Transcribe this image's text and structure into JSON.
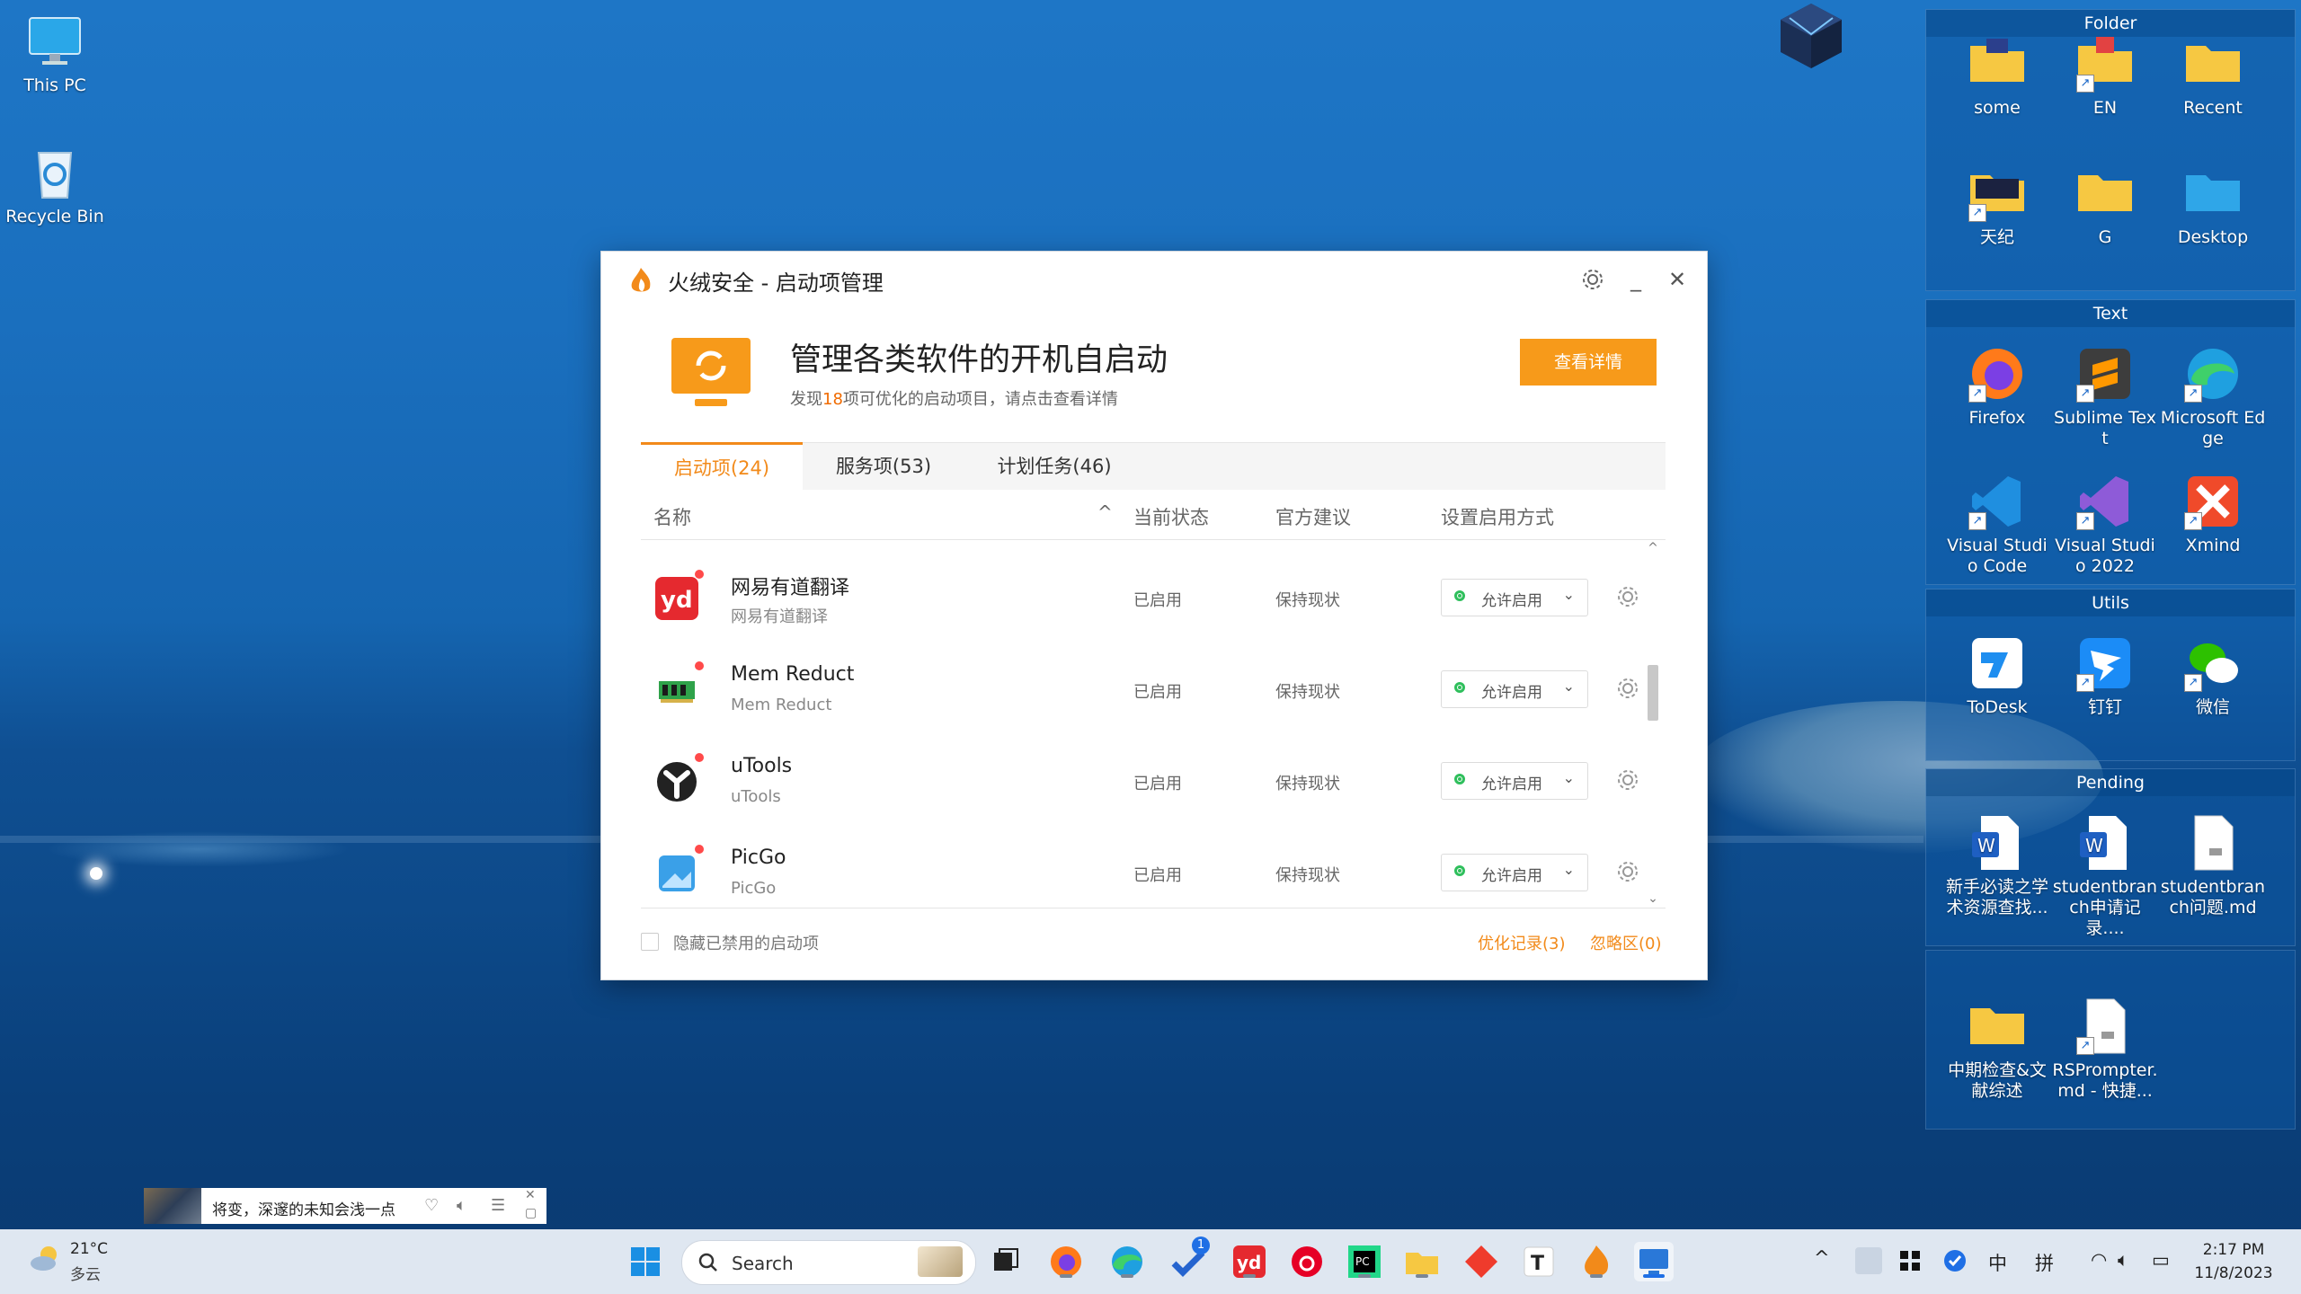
{
  "desktop": {
    "icons": [
      {
        "label": "This PC"
      },
      {
        "label": "Recycle Bin"
      }
    ]
  },
  "fences": [
    {
      "title": "Folder",
      "items": [
        {
          "label": "some"
        },
        {
          "label": "EN"
        },
        {
          "label": "Recent"
        },
        {
          "label": "天纪"
        },
        {
          "label": "G"
        },
        {
          "label": "Desktop"
        }
      ]
    },
    {
      "title": "Text",
      "items": [
        {
          "label": "Firefox"
        },
        {
          "label": "Sublime Tex t"
        },
        {
          "label": "Microsoft Ed ge"
        },
        {
          "label": "Visual Studi o Code"
        },
        {
          "label": "Visual Studi o 2022"
        },
        {
          "label": "Xmind"
        }
      ]
    },
    {
      "title": "Utils",
      "items": [
        {
          "label": "ToDesk"
        },
        {
          "label": "钉钉"
        },
        {
          "label": "微信"
        }
      ]
    },
    {
      "title": "Pending",
      "items": [
        {
          "label": "新手必读之学 术资源查找..."
        },
        {
          "label": "studentbran ch申请记录...."
        },
        {
          "label": "studentbran ch问题.md"
        }
      ]
    },
    {
      "title": "",
      "items": [
        {
          "label": "中期检查&文 献综述"
        },
        {
          "label": "RSPrompter. md - 快捷..."
        }
      ]
    }
  ],
  "window": {
    "title": "火绒安全 - 启动项管理",
    "minimize": "_",
    "close": "✕",
    "hero": {
      "title": "管理各类软件的开机自启动",
      "sub_prefix": "发现",
      "sub_count": "18",
      "sub_suffix": "项可优化的启动项目，请点击查看详情",
      "button": "查看详情"
    },
    "tabs": [
      {
        "label": "启动项(24)"
      },
      {
        "label": "服务项(53)"
      },
      {
        "label": "计划任务(46)"
      }
    ],
    "columns": {
      "name": "名称",
      "status": "当前状态",
      "advice": "官方建议",
      "mode": "设置启用方式"
    },
    "rows": [
      {
        "name": "网易有道翻译",
        "sub": "网易有道翻译",
        "status": "已启用",
        "advice": "保持现状",
        "mode": "允许启用"
      },
      {
        "name": "Mem Reduct",
        "sub": "Mem Reduct",
        "status": "已启用",
        "advice": "保持现状",
        "mode": "允许启用"
      },
      {
        "name": "uTools",
        "sub": "uTools",
        "status": "已启用",
        "advice": "保持现状",
        "mode": "允许启用"
      },
      {
        "name": "PicGo",
        "sub": "PicGo",
        "status": "已启用",
        "advice": "保持现状",
        "mode": "允许启用"
      }
    ],
    "footer": {
      "hide_disabled": "隐藏已禁用的启动项",
      "optimize_log": "优化记录(3)",
      "ignore_zone": "忽略区(0)"
    }
  },
  "music": {
    "song": "将变，深邃的未知会浅一点"
  },
  "taskbar": {
    "weather_temp": "21°C",
    "weather_desc": "多云",
    "search_label": "Search",
    "todo_badge": "1",
    "ime_lang": "中",
    "ime_mode": "拼",
    "time": "2:17 PM",
    "date": "11/8/2023"
  }
}
